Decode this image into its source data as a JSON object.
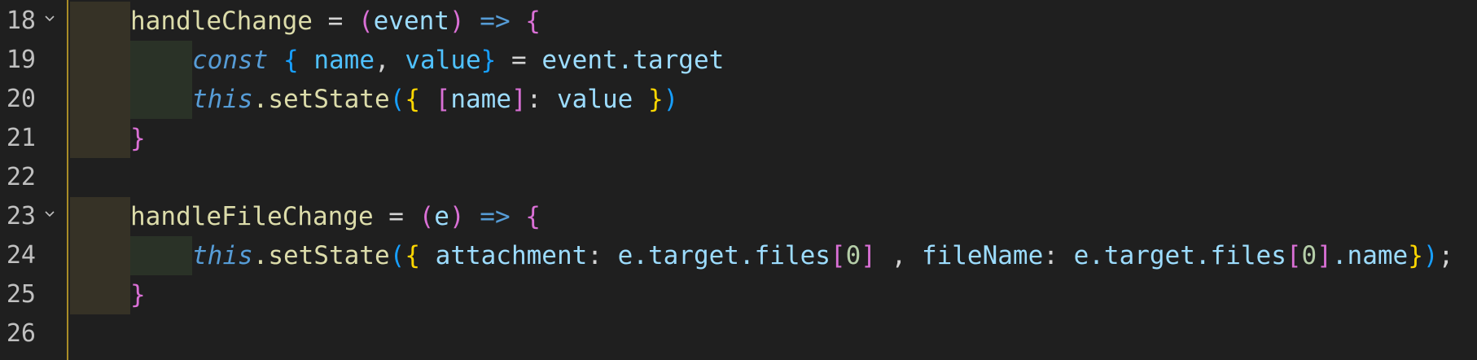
{
  "editor": {
    "lines": [
      {
        "number": "18",
        "foldable": true
      },
      {
        "number": "19",
        "foldable": false
      },
      {
        "number": "20",
        "foldable": false
      },
      {
        "number": "21",
        "foldable": false
      },
      {
        "number": "22",
        "foldable": false
      },
      {
        "number": "23",
        "foldable": true
      },
      {
        "number": "24",
        "foldable": false
      },
      {
        "number": "25",
        "foldable": false
      },
      {
        "number": "26",
        "foldable": false
      }
    ],
    "tokens": {
      "handleChange": "handleChange",
      "eq": " = ",
      "lparen": "(",
      "event": "event",
      "rparen": ")",
      "arrow": " => ",
      "lbrace": "{",
      "rbrace": "}",
      "const": "const",
      "name": "name",
      "comma": ", ",
      "value": "value",
      "event_target": "event.target",
      "this": "this",
      "setState": ".setState",
      "lbracket": "[",
      "rbracket": "]",
      "colon": ": ",
      "handleFileChange": "handleFileChange",
      "e": "e",
      "attachment": "attachment",
      "e_target_files": "e.target.files",
      "zero": "0",
      "spaced_comma": " , ",
      "fileName": "fileName",
      "dot_name": ".name",
      "semicolon": ";"
    }
  }
}
